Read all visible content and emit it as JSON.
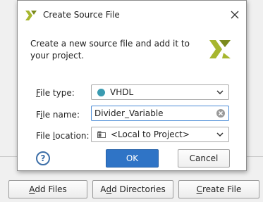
{
  "dialog": {
    "title": "Create Source File",
    "description": "Create a new source file and add it to your project.",
    "file_type": {
      "label_prefix": "F",
      "label_rest": "ile type:",
      "value": "VHDL",
      "dot_color": "#3a9bb1"
    },
    "file_name": {
      "label_prefix": "F",
      "label_underline": "i",
      "label_rest": "le name:",
      "value": "Divider_Variable"
    },
    "file_location": {
      "label_prefix": "File ",
      "label_underline": "l",
      "label_rest": "ocation:",
      "value": "<Local to Project>"
    },
    "help_label": "?",
    "ok_label": "OK",
    "cancel_label": "Cancel"
  },
  "background_buttons": {
    "add_files": {
      "underline": "A",
      "rest": "dd Files"
    },
    "add_directories": {
      "pre": "A",
      "underline": "d",
      "rest": "d Directories"
    },
    "create_file": {
      "underline": "C",
      "rest": "reate File"
    }
  },
  "colors": {
    "accent": "#2f74c6",
    "logo_green": "#a7b62e",
    "logo_dark": "#7b8a1c"
  }
}
